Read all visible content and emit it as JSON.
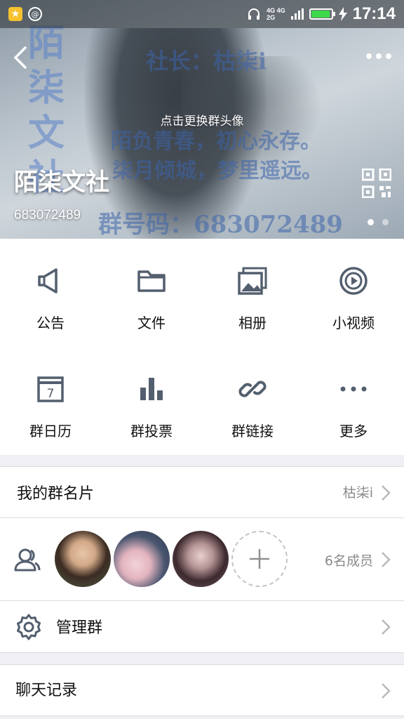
{
  "status_bar": {
    "network": "4G 4G\n2G",
    "time": "17:14",
    "battery_level": 0.95
  },
  "header": {
    "change_avatar_hint": "点击更换群头像",
    "group_name": "陌柒文社",
    "group_id": "683072489",
    "banner_watermarks": {
      "vertical": "陌柒文社",
      "leader": "社长：枯柒i",
      "line1": "陌负青春，初心永存。",
      "line2": "柒月倾城，梦里遥远。",
      "group_no": "群号码：683072489"
    },
    "page_count": 2,
    "current_page": 1
  },
  "features": [
    {
      "label": "公告",
      "icon": "megaphone-icon"
    },
    {
      "label": "文件",
      "icon": "folder-icon"
    },
    {
      "label": "相册",
      "icon": "photo-album-icon"
    },
    {
      "label": "小视频",
      "icon": "video-play-icon"
    },
    {
      "label": "群日历",
      "icon": "calendar-icon"
    },
    {
      "label": "群投票",
      "icon": "bar-chart-icon"
    },
    {
      "label": "群链接",
      "icon": "link-icon"
    },
    {
      "label": "更多",
      "icon": "more-dots-icon"
    }
  ],
  "my_card": {
    "label": "我的群名片",
    "value": "枯柒i"
  },
  "members": {
    "count_label": "6名成员"
  },
  "manage": {
    "label": "管理群"
  },
  "chat_history": {
    "label": "聊天记录"
  },
  "colors": {
    "icon_gray": "#535f6e",
    "chevron": "#b9b9b9",
    "background": "#efeff4"
  }
}
